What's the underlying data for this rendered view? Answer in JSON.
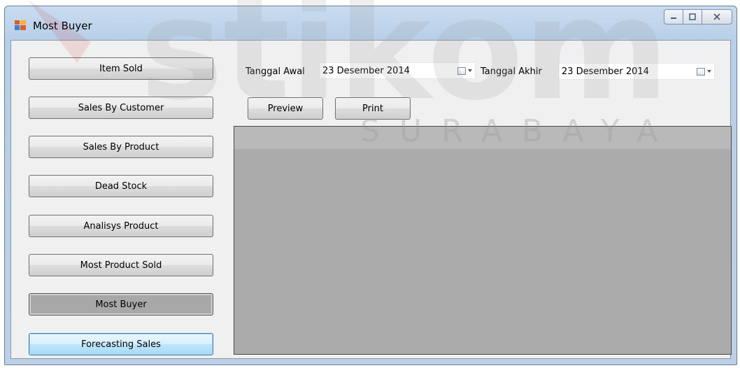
{
  "window": {
    "title": "Most Buyer"
  },
  "sidebar": {
    "buttons": [
      {
        "label": "Item Sold"
      },
      {
        "label": "Sales By Customer"
      },
      {
        "label": "Sales By Product"
      },
      {
        "label": "Dead Stock"
      },
      {
        "label": "Analisys Product"
      },
      {
        "label": "Most Product Sold"
      },
      {
        "label": "Most Buyer"
      },
      {
        "label": "Forecasting Sales"
      }
    ]
  },
  "filters": {
    "start_label": "Tanggal Awal",
    "start_value": "23 Desember  2014",
    "end_label": "Tanggal Akhir",
    "end_value": "23 Desember 2014"
  },
  "actions": {
    "preview_label": "Preview",
    "print_label": "Print"
  },
  "watermark": {
    "brand": "stikom",
    "city": "SURABAYA",
    "brand_color": "#cc2229"
  }
}
